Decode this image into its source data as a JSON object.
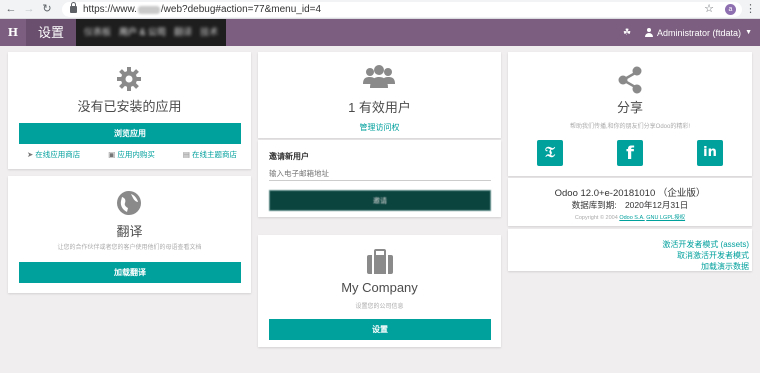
{
  "browser": {
    "url_prefix": "https://www.",
    "url_suffix": "/web?debug#action=77&menu_id=4",
    "extension_badge": "a"
  },
  "navbar": {
    "home_label": "H",
    "app_title": "设置",
    "menus": [
      {
        "label": "仪表板",
        "active": false
      },
      {
        "label": "用户 & 公司",
        "active": true
      },
      {
        "label": "翻译",
        "active": false
      },
      {
        "label": "技术",
        "active": false
      }
    ],
    "user_label": "Administrator (ftdata)"
  },
  "apps_card": {
    "title": "没有已安装的应用",
    "button_label": "浏览应用",
    "links": {
      "online_store": "在线应用商店",
      "in_app_purchase": "应用内购买",
      "theme_store": "在线主题商店"
    }
  },
  "translate_card": {
    "title": "翻译",
    "description": "让您的合作伙伴或者您的客户使用他们的母语查看文档",
    "button_label": "加载翻译"
  },
  "users_card": {
    "title": "1 有效用户",
    "manage_link": "管理访问权",
    "invite_label": "邀请新用户",
    "email_placeholder": "输入电子邮箱地址",
    "invite_button": "邀请"
  },
  "company_card": {
    "title": "My Company",
    "subtitle": "设置您的公司信息",
    "button_label": "设置"
  },
  "share_card": {
    "title": "分享",
    "subtitle": "帮助我们传播,和你的朋友们分享Odoo的精彩!",
    "social": [
      "twitter",
      "facebook",
      "linkedin"
    ]
  },
  "version_card": {
    "version": "Odoo 12.0+e-20181010 （企业版）",
    "expiry_label": "数据库到期:",
    "expiry_date": "2020年12月31日",
    "copyright_prefix": "Copyright © 2004",
    "copyright_link": "Odoo S.A.",
    "license_link": "GNU LGPL授权"
  },
  "dev_links": {
    "activate_assets": "激活开发者模式 (assets)",
    "deactivate": "取消激活开发者模式",
    "load_demo": "加载演示数据"
  },
  "colors": {
    "navbar": "#7c5f80",
    "accent": "#00a09d",
    "background": "#f0eeee"
  }
}
